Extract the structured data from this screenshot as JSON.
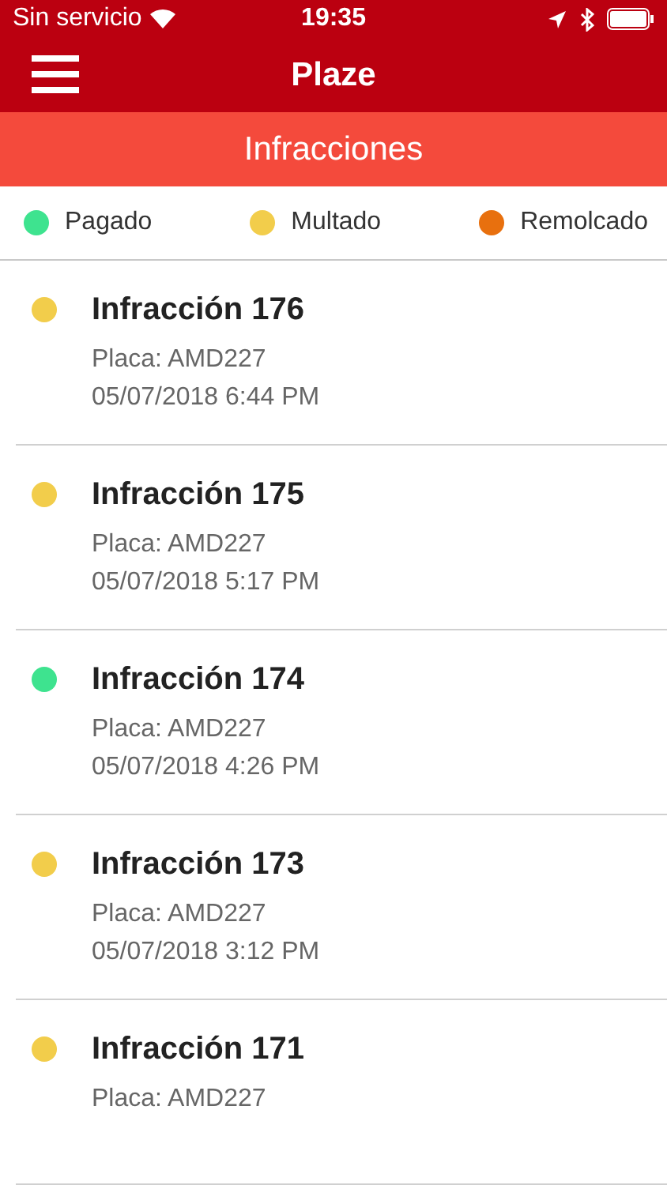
{
  "status_bar": {
    "carrier": "Sin servicio",
    "time": "19:35"
  },
  "header": {
    "title": "Plaze"
  },
  "section": {
    "title": "Infracciones"
  },
  "legend": [
    {
      "label": "Pagado",
      "color": "#3ee38f"
    },
    {
      "label": "Multado",
      "color": "#f2cd4b"
    },
    {
      "label": "Remolcado",
      "color": "#e8700e"
    }
  ],
  "infractions": [
    {
      "title": "Infracción 176",
      "plate": "Placa: AMD227",
      "date": "05/07/2018 6:44 PM",
      "color": "#f2cd4b"
    },
    {
      "title": "Infracción 175",
      "plate": "Placa: AMD227",
      "date": "05/07/2018 5:17 PM",
      "color": "#f2cd4b"
    },
    {
      "title": "Infracción 174",
      "plate": "Placa: AMD227",
      "date": "05/07/2018 4:26 PM",
      "color": "#3ee38f"
    },
    {
      "title": "Infracción 173",
      "plate": "Placa: AMD227",
      "date": "05/07/2018 3:12 PM",
      "color": "#f2cd4b"
    },
    {
      "title": "Infracción 171",
      "plate": "Placa: AMD227",
      "color": "#f2cd4b"
    }
  ]
}
